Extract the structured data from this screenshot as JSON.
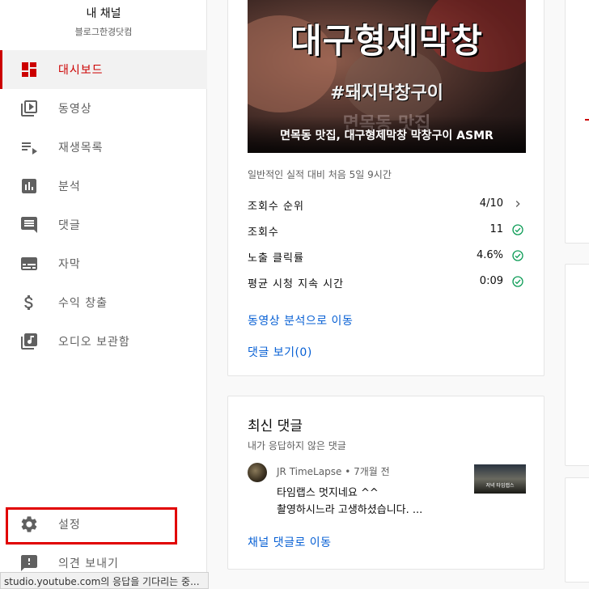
{
  "channel": {
    "title": "내 채널",
    "name": "블로그한경닷컴"
  },
  "nav": {
    "items": [
      {
        "label": "대시보드",
        "icon": "dashboard-icon",
        "active": true
      },
      {
        "label": "동영상",
        "icon": "video-library-icon"
      },
      {
        "label": "재생목록",
        "icon": "playlist-icon"
      },
      {
        "label": "분석",
        "icon": "analytics-icon"
      },
      {
        "label": "댓글",
        "icon": "comment-icon"
      },
      {
        "label": "자막",
        "icon": "subtitles-icon"
      },
      {
        "label": "수익 창출",
        "icon": "dollar-icon"
      },
      {
        "label": "오디오 보관함",
        "icon": "audio-library-icon"
      }
    ],
    "bottom": [
      {
        "label": "설정",
        "icon": "gear-icon"
      },
      {
        "label": "의견 보내기",
        "icon": "feedback-icon"
      }
    ]
  },
  "video": {
    "thumb_title": "대구형제막창",
    "thumb_tag": "#돼지막창구이",
    "thumb_ghost": "면목동 맛집",
    "caption": "면목동 맛집, 대구형제막창 막창구이 ASMR",
    "perf_note": "일반적인 실적 대비 처음 5일 9시간",
    "metrics": [
      {
        "label": "조회수 순위",
        "value": "4/10",
        "icon": "chevron-right-icon"
      },
      {
        "label": "조회수",
        "value": "11",
        "icon": "check-circle-icon"
      },
      {
        "label": "노출 클릭률",
        "value": "4.6%",
        "icon": "check-circle-icon"
      },
      {
        "label": "평균 시청 지속 시간",
        "value": "0:09",
        "icon": "check-circle-icon"
      }
    ],
    "analytics_link": "동영상 분석으로 이동",
    "comments_link": "댓글 보기(0)"
  },
  "comments": {
    "title": "최신 댓글",
    "subtitle": "내가 응답하지 않은 댓글",
    "author": "JR TimeLapse",
    "time": "7개월 전",
    "text_line1": "타임랩스 멋지네요 ^^",
    "text_line2": "촬영하시느라 고생하셨습니다. ...",
    "thumb_text": "저녁 타임랩스",
    "channel_link": "채널 댓글로 이동"
  },
  "status": {
    "text": "studio.youtube.com의 응답을 기다리는 중..."
  },
  "colors": {
    "accent": "#cc0000",
    "link": "#065fd4",
    "check": "#0f9d58",
    "highlight": "#e10000"
  }
}
